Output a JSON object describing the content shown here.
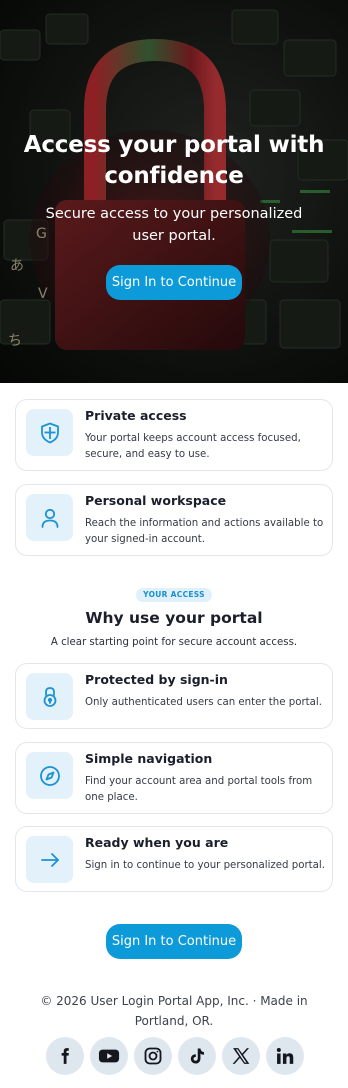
{
  "hero": {
    "title": "Access your portal with confidence",
    "subtitle": "Secure access to your personalized user portal.",
    "cta_label": "Sign In to Continue"
  },
  "features": [
    {
      "title": "Private access",
      "text": "Your portal keeps account access focused, secure, and easy to use.",
      "icon": "shield-icon"
    },
    {
      "title": "Personal workspace",
      "text": "Reach the information and actions available to your signed-in account.",
      "icon": "user-icon"
    }
  ],
  "section": {
    "badge": "YOUR ACCESS",
    "title": "Why use your portal",
    "subtitle": "A clear starting point for secure account access."
  },
  "benefits": [
    {
      "title": "Protected by sign-in",
      "text": "Only authenticated users can enter the portal.",
      "icon": "lock-icon"
    },
    {
      "title": "Simple navigation",
      "text": "Find your account area and portal tools from one place.",
      "icon": "compass-icon"
    },
    {
      "title": "Ready when you are",
      "text": "Sign in to continue to your personalized portal.",
      "icon": "arrow-right-icon"
    }
  ],
  "bottom_cta": {
    "label": "Sign In to Continue"
  },
  "footer": {
    "text": "© 2026 User Login Portal App, Inc. · Made in Portland, OR."
  },
  "socials": [
    "facebook-icon",
    "youtube-icon",
    "instagram-icon",
    "tiktok-icon",
    "x-icon",
    "linkedin-icon"
  ],
  "colors": {
    "accent": "#0d9ad9",
    "icon_bg": "#e2f1fa",
    "social_bg": "#dfe7ee"
  }
}
